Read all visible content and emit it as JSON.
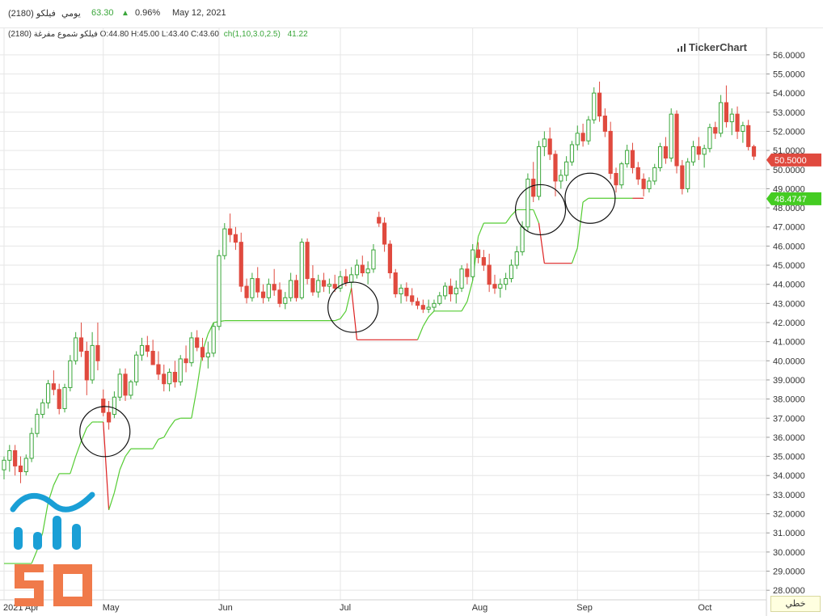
{
  "topbar": {
    "name": "فيلكو (2180)",
    "period": "يومي",
    "last_price": "63.30",
    "change_pct": "0.96%",
    "date": "May 12, 2021"
  },
  "legend": {
    "series_label": "فيلكو شموع مفرغة (2180)",
    "ohlc": "O:44.80 H:45.00 L:43.40 C:43.60",
    "indicator_label": "ch(1,10,3.0,2.5)",
    "indicator_value": "41.22"
  },
  "watermark": "TickerChart",
  "mode_button": "خطي",
  "colors": {
    "up": "#3aa63a",
    "down": "#e04a3f",
    "stop_up": "#55cc33",
    "stop_down": "#dd2222",
    "grid": "#e6e6e6",
    "last_price_tag": "#e04a3f",
    "indicator_tag": "#44cc22",
    "logo_blue": "#1a9fd6",
    "logo_orange": "#f07a4a"
  },
  "chart_data": {
    "type": "candlestick",
    "y_axis": {
      "min": 27.5,
      "max": 56.5,
      "position": "right",
      "tick_labels": [
        "28.0000",
        "29.0000",
        "30.0000",
        "31.0000",
        "32.0000",
        "33.0000",
        "34.0000",
        "35.0000",
        "36.0000",
        "37.0000",
        "38.0000",
        "39.0000",
        "40.0000",
        "41.0000",
        "42.0000",
        "43.0000",
        "44.0000",
        "45.0000",
        "46.0000",
        "47.0000",
        "48.0000",
        "49.0000",
        "50.0000",
        "51.0000",
        "52.0000",
        "53.0000",
        "54.0000",
        "55.0000",
        "56.0000"
      ]
    },
    "x_axis": {
      "labels": [
        {
          "label": "2021 Apr",
          "index": 0
        },
        {
          "label": "May",
          "index": 18
        },
        {
          "label": "Jun",
          "index": 39
        },
        {
          "label": "Jul",
          "index": 61
        },
        {
          "label": "Aug",
          "index": 85
        },
        {
          "label": "Sep",
          "index": 104
        },
        {
          "label": "Oct",
          "index": 126
        }
      ]
    },
    "candles": [
      [
        34.3,
        35.0,
        33.8,
        34.8
      ],
      [
        34.8,
        35.6,
        34.2,
        35.3
      ],
      [
        35.3,
        35.6,
        34.0,
        34.5
      ],
      [
        34.5,
        35.0,
        33.6,
        34.2
      ],
      [
        34.2,
        35.1,
        34.0,
        34.9
      ],
      [
        34.9,
        36.5,
        34.7,
        36.2
      ],
      [
        36.2,
        37.5,
        36.0,
        37.2
      ],
      [
        37.2,
        38.0,
        37.0,
        37.8
      ],
      [
        37.8,
        39.0,
        37.5,
        38.8
      ],
      [
        38.8,
        39.5,
        38.2,
        38.5
      ],
      [
        38.5,
        38.8,
        37.2,
        37.5
      ],
      [
        37.5,
        38.8,
        37.3,
        38.6
      ],
      [
        38.6,
        40.3,
        38.4,
        40.0
      ],
      [
        40.0,
        41.5,
        39.8,
        41.2
      ],
      [
        41.2,
        42.0,
        40.2,
        40.5
      ],
      [
        40.5,
        41.0,
        38.2,
        39.0
      ],
      [
        39.0,
        41.5,
        38.8,
        40.8
      ],
      [
        40.8,
        42.0,
        39.5,
        40.0
      ],
      [
        38.0,
        38.5,
        37.1,
        37.3
      ],
      [
        37.3,
        37.9,
        36.4,
        36.8
      ],
      [
        37.2,
        38.4,
        37.0,
        38.1
      ],
      [
        38.1,
        39.6,
        37.9,
        39.3
      ],
      [
        39.3,
        39.6,
        37.9,
        38.2
      ],
      [
        38.2,
        39.0,
        38.0,
        38.9
      ],
      [
        38.9,
        40.5,
        38.7,
        40.3
      ],
      [
        40.3,
        41.2,
        40.0,
        40.8
      ],
      [
        40.8,
        41.3,
        40.2,
        40.5
      ],
      [
        40.5,
        41.1,
        39.8,
        39.8
      ],
      [
        39.8,
        40.5,
        39.0,
        39.3
      ],
      [
        39.3,
        39.8,
        38.4,
        38.8
      ],
      [
        38.8,
        39.6,
        38.4,
        39.4
      ],
      [
        39.4,
        40.0,
        38.6,
        38.9
      ],
      [
        38.9,
        40.3,
        38.7,
        40.1
      ],
      [
        40.1,
        40.8,
        39.4,
        39.9
      ],
      [
        39.9,
        41.5,
        39.7,
        41.2
      ],
      [
        41.2,
        41.6,
        40.5,
        40.7
      ],
      [
        40.7,
        41.2,
        40.0,
        40.2
      ],
      [
        40.2,
        41.0,
        39.6,
        40.4
      ],
      [
        40.4,
        42.0,
        40.2,
        41.8
      ],
      [
        41.8,
        45.8,
        41.6,
        45.5
      ],
      [
        45.5,
        47.2,
        45.3,
        46.9
      ],
      [
        46.9,
        47.7,
        46.2,
        46.6
      ],
      [
        46.6,
        47.0,
        45.8,
        46.2
      ],
      [
        46.2,
        46.7,
        43.6,
        43.9
      ],
      [
        43.9,
        44.3,
        43.0,
        43.3
      ],
      [
        43.3,
        44.6,
        43.1,
        44.3
      ],
      [
        44.3,
        44.9,
        43.3,
        43.6
      ],
      [
        43.6,
        44.0,
        43.0,
        43.3
      ],
      [
        43.3,
        44.3,
        43.1,
        44.0
      ],
      [
        44.0,
        44.8,
        43.4,
        43.7
      ],
      [
        43.7,
        44.1,
        42.8,
        43.0
      ],
      [
        43.0,
        43.6,
        42.7,
        43.3
      ],
      [
        43.3,
        44.6,
        43.1,
        44.2
      ],
      [
        44.2,
        44.5,
        43.1,
        43.3
      ],
      [
        43.3,
        46.4,
        43.2,
        46.2
      ],
      [
        46.2,
        46.4,
        44.0,
        44.3
      ],
      [
        44.3,
        45.0,
        43.4,
        43.6
      ],
      [
        43.6,
        44.5,
        43.3,
        44.2
      ],
      [
        44.2,
        44.6,
        43.6,
        43.9
      ],
      [
        43.9,
        44.3,
        43.5,
        44.0
      ],
      [
        44.0,
        44.5,
        43.6,
        43.8
      ],
      [
        43.8,
        44.7,
        43.6,
        44.4
      ],
      [
        44.4,
        44.8,
        43.9,
        44.1
      ],
      [
        44.1,
        44.9,
        43.8,
        44.5
      ],
      [
        44.5,
        45.3,
        44.3,
        45.0
      ],
      [
        45.0,
        45.5,
        44.4,
        44.6
      ],
      [
        44.6,
        45.2,
        44.0,
        44.8
      ],
      [
        44.8,
        46.1,
        44.6,
        45.8
      ],
      [
        47.5,
        47.8,
        47.0,
        47.2
      ],
      [
        47.2,
        47.5,
        45.7,
        46.1
      ],
      [
        46.1,
        46.3,
        44.3,
        44.6
      ],
      [
        44.6,
        44.8,
        43.3,
        43.5
      ],
      [
        43.5,
        44.0,
        43.0,
        43.8
      ],
      [
        43.8,
        44.1,
        43.1,
        43.4
      ],
      [
        43.4,
        43.8,
        42.9,
        43.1
      ],
      [
        43.1,
        43.3,
        42.7,
        42.9
      ],
      [
        42.9,
        43.2,
        42.5,
        42.7
      ],
      [
        42.7,
        43.2,
        42.5,
        42.8
      ],
      [
        42.8,
        43.2,
        42.6,
        43.0
      ],
      [
        43.0,
        43.6,
        42.9,
        43.4
      ],
      [
        43.4,
        44.1,
        43.2,
        43.9
      ],
      [
        43.9,
        44.3,
        43.1,
        43.5
      ],
      [
        43.5,
        44.2,
        43.0,
        43.8
      ],
      [
        43.8,
        45.0,
        43.6,
        44.8
      ],
      [
        44.8,
        45.1,
        44.0,
        44.4
      ],
      [
        44.4,
        46.1,
        44.2,
        45.8
      ],
      [
        45.8,
        46.2,
        45.1,
        45.4
      ],
      [
        45.4,
        45.8,
        44.7,
        45.0
      ],
      [
        45.0,
        45.6,
        43.6,
        44.0
      ],
      [
        44.0,
        44.5,
        43.5,
        43.8
      ],
      [
        43.8,
        44.3,
        43.3,
        44.0
      ],
      [
        44.0,
        44.6,
        43.7,
        44.3
      ],
      [
        44.3,
        45.3,
        44.1,
        45.0
      ],
      [
        45.0,
        46.0,
        44.8,
        45.7
      ],
      [
        45.7,
        47.3,
        45.5,
        47.0
      ],
      [
        47.0,
        49.8,
        46.8,
        49.5
      ],
      [
        49.5,
        50.4,
        48.3,
        48.6
      ],
      [
        48.6,
        51.5,
        48.4,
        51.2
      ],
      [
        51.2,
        52.0,
        50.7,
        51.6
      ],
      [
        51.6,
        52.2,
        50.5,
        50.8
      ],
      [
        50.8,
        51.0,
        48.6,
        49.4
      ],
      [
        49.4,
        50.0,
        49.0,
        49.7
      ],
      [
        49.7,
        50.7,
        49.4,
        50.4
      ],
      [
        50.4,
        51.5,
        50.2,
        51.3
      ],
      [
        51.3,
        52.3,
        51.0,
        51.9
      ],
      [
        51.9,
        52.4,
        51.2,
        51.5
      ],
      [
        51.5,
        52.8,
        51.3,
        52.6
      ],
      [
        52.6,
        54.3,
        52.4,
        54.0
      ],
      [
        54.0,
        54.6,
        52.5,
        52.8
      ],
      [
        52.8,
        53.2,
        51.7,
        52.0
      ],
      [
        52.0,
        52.5,
        49.5,
        49.8
      ],
      [
        49.8,
        50.1,
        48.8,
        49.2
      ],
      [
        49.2,
        50.4,
        49.0,
        50.3
      ],
      [
        50.3,
        51.3,
        50.1,
        51.0
      ],
      [
        51.0,
        51.4,
        49.8,
        50.1
      ],
      [
        50.1,
        50.4,
        49.2,
        49.5
      ],
      [
        49.5,
        49.8,
        48.6,
        49.0
      ],
      [
        49.0,
        49.6,
        48.8,
        49.4
      ],
      [
        49.4,
        50.3,
        49.2,
        50.1
      ],
      [
        50.1,
        51.4,
        49.9,
        51.2
      ],
      [
        51.2,
        51.7,
        50.3,
        50.6
      ],
      [
        50.6,
        53.2,
        50.4,
        52.9
      ],
      [
        52.9,
        53.1,
        49.8,
        50.2
      ],
      [
        50.2,
        50.5,
        48.7,
        49.0
      ],
      [
        49.0,
        50.6,
        48.8,
        50.4
      ],
      [
        50.4,
        51.5,
        50.2,
        51.2
      ],
      [
        51.2,
        51.7,
        50.5,
        50.8
      ],
      [
        50.8,
        51.3,
        50.1,
        51.1
      ],
      [
        51.1,
        52.4,
        50.9,
        52.2
      ],
      [
        52.2,
        52.5,
        51.6,
        51.9
      ],
      [
        51.9,
        53.9,
        51.7,
        53.5
      ],
      [
        53.5,
        54.4,
        52.2,
        52.5
      ],
      [
        52.5,
        53.2,
        51.8,
        52.9
      ],
      [
        52.9,
        53.3,
        51.6,
        52.0
      ],
      [
        52.0,
        52.5,
        51.4,
        52.3
      ],
      [
        52.3,
        52.6,
        51.0,
        51.2
      ],
      [
        51.2,
        51.3,
        50.5,
        50.7
      ]
    ],
    "stop_line": [
      [
        0,
        29.4,
        "up"
      ],
      [
        5,
        29.4,
        "up"
      ],
      [
        6,
        30.1,
        "up"
      ],
      [
        7,
        31.0,
        "up"
      ],
      [
        8,
        32.6,
        "up"
      ],
      [
        9,
        33.5,
        "up"
      ],
      [
        10,
        34.1,
        "up"
      ],
      [
        12,
        34.1,
        "up"
      ],
      [
        13,
        35.0,
        "up"
      ],
      [
        14,
        35.8,
        "up"
      ],
      [
        15,
        36.5,
        "up"
      ],
      [
        16,
        36.8,
        "up"
      ],
      [
        17,
        36.8,
        "up"
      ],
      [
        18,
        36.8,
        "down"
      ],
      [
        19,
        32.2,
        "up"
      ],
      [
        20,
        33.1,
        "up"
      ],
      [
        21,
        34.3,
        "up"
      ],
      [
        22,
        35.0,
        "up"
      ],
      [
        23,
        35.4,
        "up"
      ],
      [
        27,
        35.4,
        "up"
      ],
      [
        28,
        35.9,
        "up"
      ],
      [
        29,
        36.0,
        "up"
      ],
      [
        30,
        36.5,
        "up"
      ],
      [
        31,
        36.9,
        "up"
      ],
      [
        32,
        37.0,
        "up"
      ],
      [
        34,
        37.0,
        "up"
      ],
      [
        35,
        38.6,
        "up"
      ],
      [
        36,
        40.5,
        "up"
      ],
      [
        37,
        41.4,
        "up"
      ],
      [
        38,
        42.0,
        "up"
      ],
      [
        40,
        42.1,
        "up"
      ],
      [
        60,
        42.1,
        "up"
      ],
      [
        61,
        42.2,
        "up"
      ],
      [
        62,
        42.6,
        "up"
      ],
      [
        63,
        43.8,
        "down"
      ],
      [
        64,
        41.1,
        "down"
      ],
      [
        75,
        41.1,
        "up"
      ],
      [
        76,
        41.8,
        "up"
      ],
      [
        77,
        42.3,
        "up"
      ],
      [
        78,
        42.6,
        "up"
      ],
      [
        83,
        42.6,
        "up"
      ],
      [
        84,
        43.1,
        "up"
      ],
      [
        85,
        44.2,
        "up"
      ],
      [
        86,
        46.5,
        "up"
      ],
      [
        87,
        47.2,
        "up"
      ],
      [
        91,
        47.2,
        "up"
      ],
      [
        92,
        47.6,
        "up"
      ],
      [
        93,
        47.9,
        "up"
      ],
      [
        96,
        47.9,
        "up"
      ],
      [
        97,
        47.2,
        "down"
      ],
      [
        98,
        45.1,
        "down"
      ],
      [
        103,
        45.1,
        "up"
      ],
      [
        104,
        45.9,
        "up"
      ],
      [
        105,
        48.3,
        "up"
      ],
      [
        106,
        48.5,
        "up"
      ],
      [
        114,
        48.5,
        "down"
      ],
      [
        116,
        48.5,
        "down"
      ]
    ],
    "circles": [
      {
        "index": 18,
        "price": 36.3
      },
      {
        "index": 63,
        "price": 42.8
      },
      {
        "index": 97,
        "price": 47.9
      },
      {
        "index": 106,
        "price": 48.5
      }
    ],
    "last_price_label": "50.5000",
    "last_price_value": 50.5,
    "indicator_label": "48.4747",
    "indicator_value": 48.4747
  }
}
